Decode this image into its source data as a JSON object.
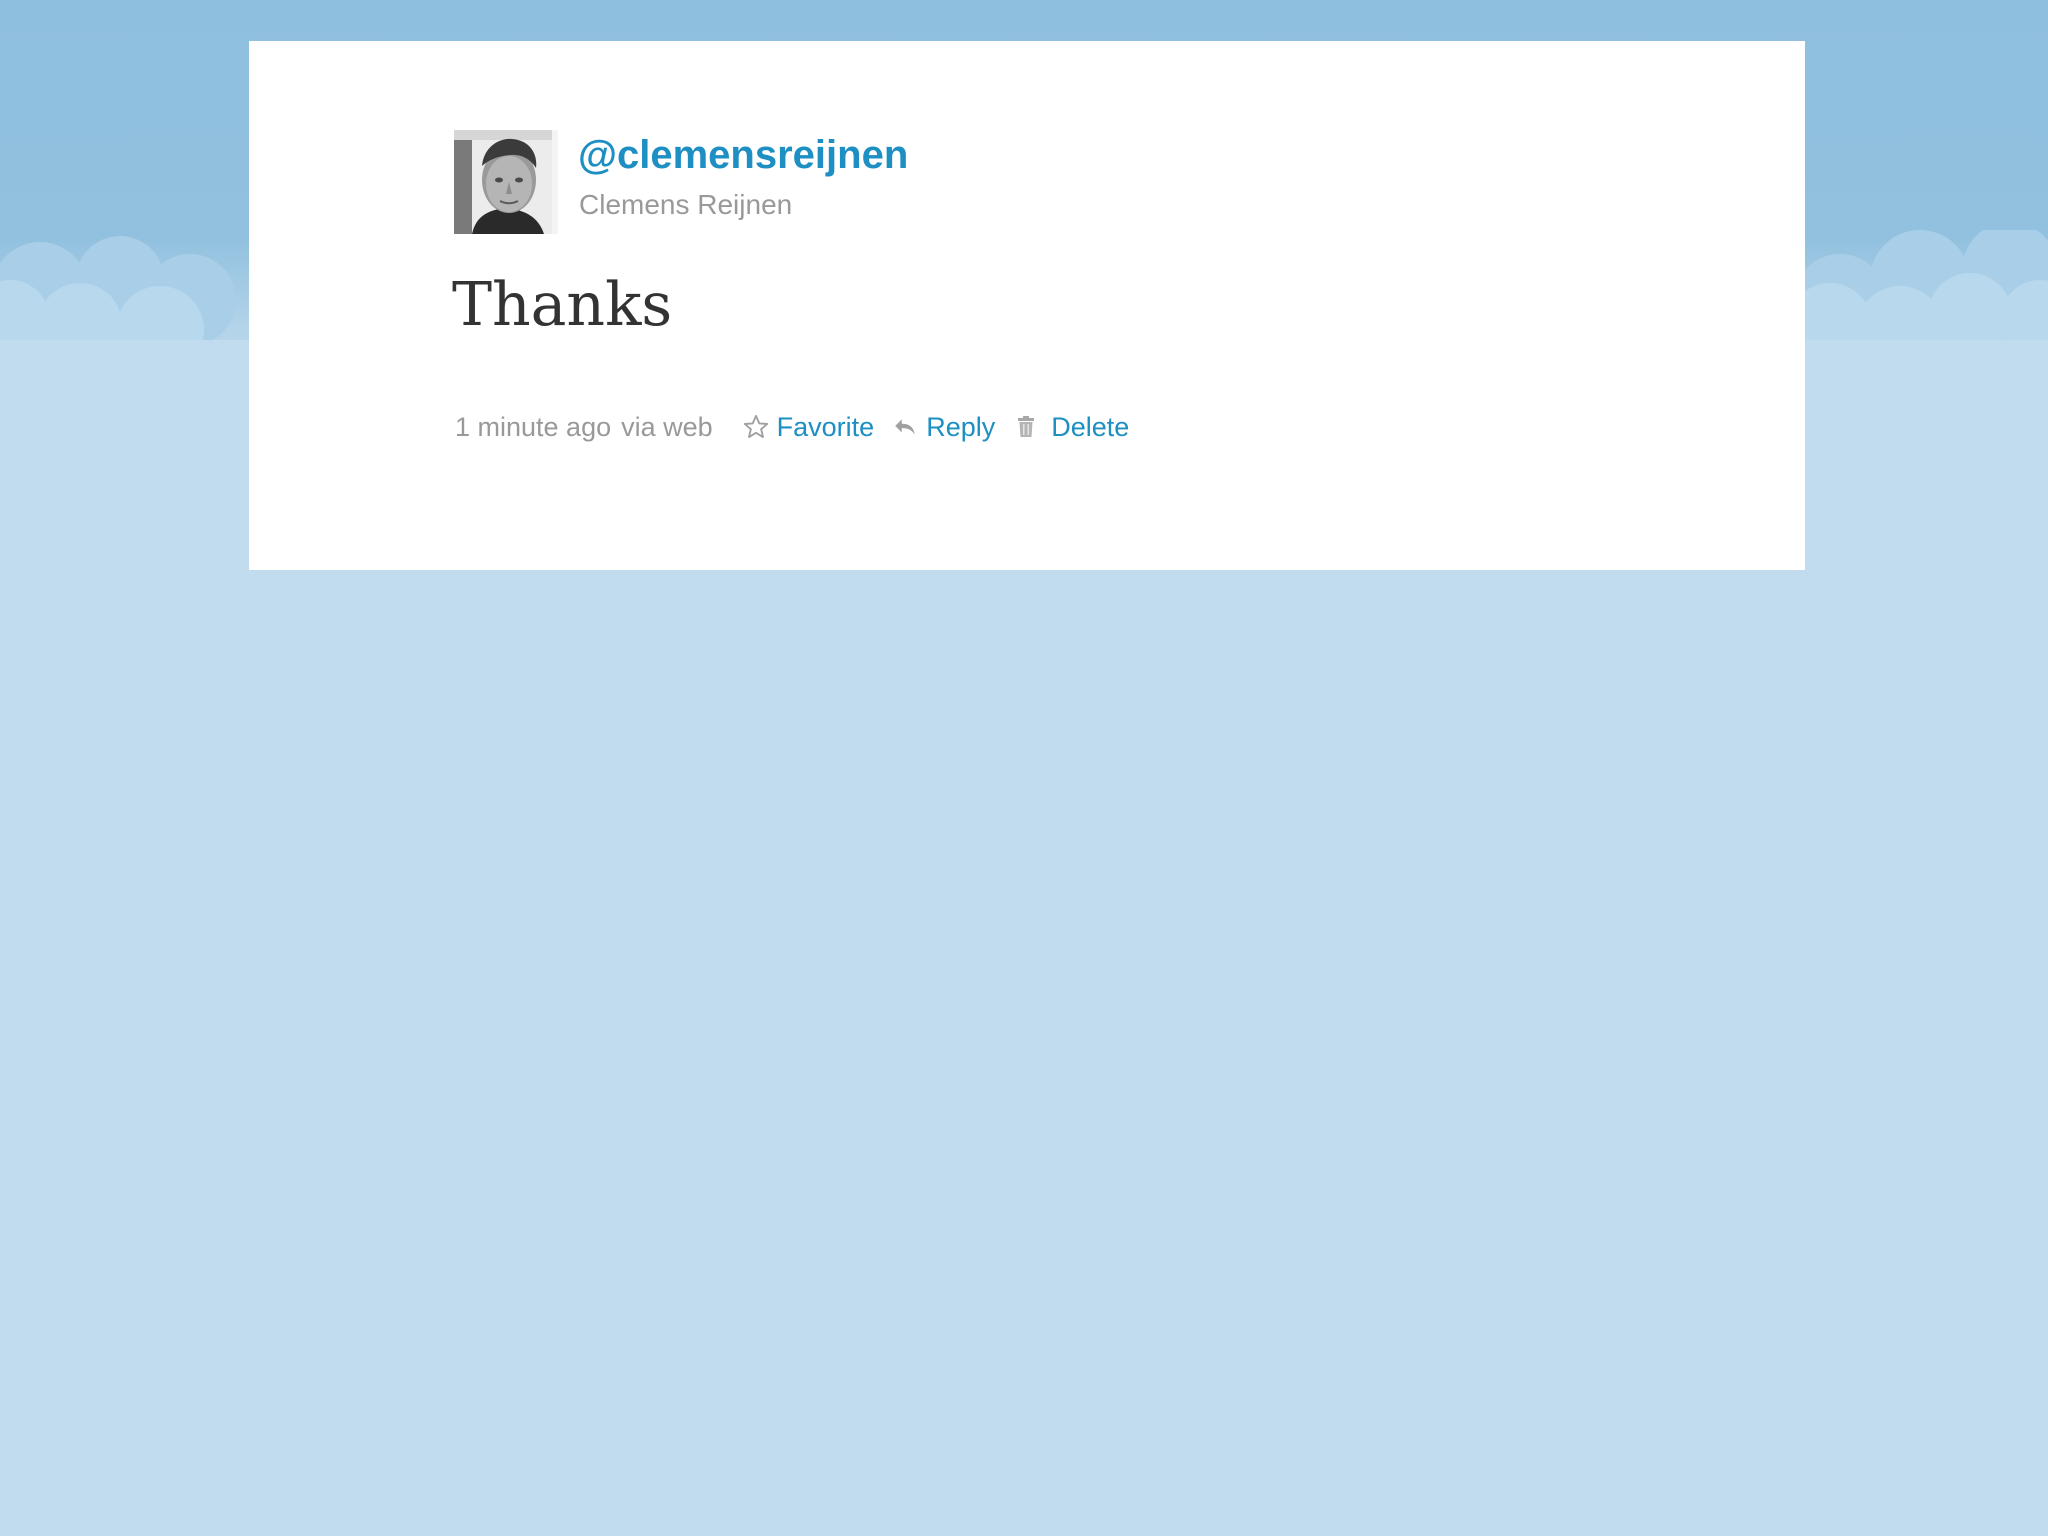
{
  "tweet": {
    "screen_name": "@clemensreijnen",
    "full_name": "Clemens Reijnen",
    "text": "Thanks",
    "timestamp": "1 minute ago",
    "via": "via web"
  },
  "actions": {
    "favorite_label": "Favorite",
    "reply_label": "Reply",
    "delete_label": "Delete"
  },
  "icons": {
    "favorite": "star-icon",
    "reply": "reply-arrow-icon",
    "delete": "trash-icon"
  },
  "colors": {
    "link": "#1d8fc3",
    "muted_text": "#999999",
    "body_text": "#333333",
    "sky": "#92c1df",
    "background": "#c1dcef",
    "card": "#ffffff"
  }
}
